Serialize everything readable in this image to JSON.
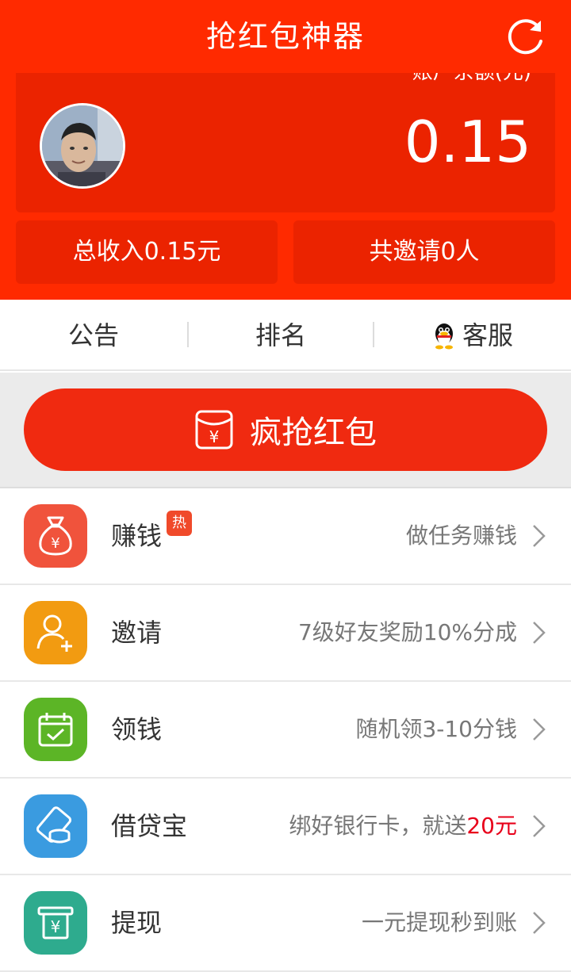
{
  "header": {
    "title": "抢红包神器",
    "refresh_icon": "refresh-icon",
    "background": "#ff2a00"
  },
  "balance": {
    "label": "账户余额(元)",
    "value": "0.15"
  },
  "stats": {
    "income": "总收入0.15元",
    "invites": "共邀请0人"
  },
  "quicknav": {
    "announce": "公告",
    "ranking": "排名",
    "service": "客服",
    "service_icon": "qq-penguin-icon"
  },
  "grab": {
    "label": "疯抢红包",
    "icon": "red-envelope-icon"
  },
  "rows": [
    {
      "title": "赚钱",
      "badge": "热",
      "desc": "做任务赚钱",
      "icon": "money-bag-icon",
      "color": "#f0533c"
    },
    {
      "title": "邀请",
      "desc": "7级好友奖励10%分成",
      "icon": "add-user-icon",
      "color": "#f29b11"
    },
    {
      "title": "领钱",
      "desc": "随机领3-10分钱",
      "icon": "calendar-check-icon",
      "color": "#5cb526"
    },
    {
      "title": "借贷宝",
      "desc_prefix": "绑好银行卡，就送",
      "desc_highlight": "20元",
      "icon": "card-coins-icon",
      "color": "#3a9be0",
      "highlight_color": "#e8001a"
    },
    {
      "title": "提现",
      "desc": "一元提现秒到账",
      "icon": "atm-withdraw-icon",
      "color": "#2eab8e"
    }
  ]
}
